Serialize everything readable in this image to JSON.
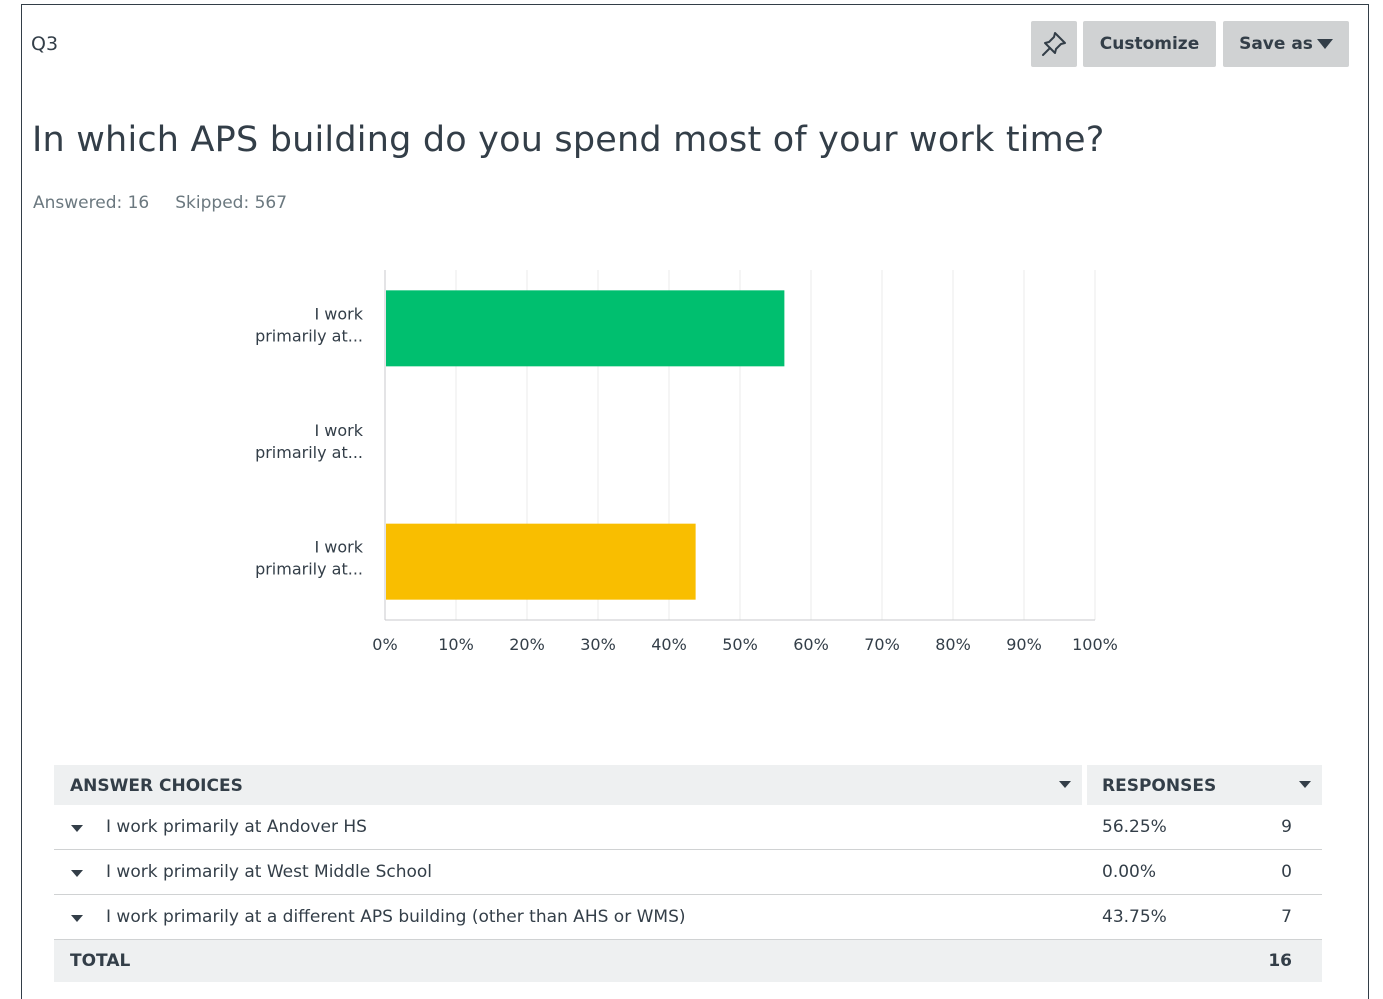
{
  "question": {
    "number": "Q3",
    "title": "In which APS building do you spend most of your work time?",
    "answered_label": "Answered: 16",
    "skipped_label": "Skipped: 567"
  },
  "toolbar": {
    "pin_icon": "pin-icon",
    "customize_label": "Customize",
    "save_as_label": "Save as"
  },
  "chart_data": {
    "type": "bar",
    "orientation": "horizontal",
    "categories": [
      "I work primarily at...",
      "I work primarily at...",
      "I work primarily at..."
    ],
    "category_lines": [
      [
        "I work",
        "primarily at..."
      ],
      [
        "I work",
        "primarily at..."
      ],
      [
        "I work",
        "primarily at..."
      ]
    ],
    "values": [
      56.25,
      0,
      43.75
    ],
    "colors": [
      "#00bf6f",
      "#6bc8cd",
      "#f9be00"
    ],
    "xlim": [
      0,
      100
    ],
    "xticks": [
      "0%",
      "10%",
      "20%",
      "30%",
      "40%",
      "50%",
      "60%",
      "70%",
      "80%",
      "90%",
      "100%"
    ],
    "grid": true
  },
  "table": {
    "header_choices": "ANSWER CHOICES",
    "header_responses": "RESPONSES",
    "rows": [
      {
        "choice": "I work primarily at Andover HS",
        "percent": "56.25%",
        "count": "9"
      },
      {
        "choice": "I work primarily at West Middle School",
        "percent": "0.00%",
        "count": "0"
      },
      {
        "choice": "I work primarily at a different APS building (other than AHS or WMS)",
        "percent": "43.75%",
        "count": "7"
      }
    ],
    "total_label": "TOTAL",
    "total_value": "16"
  }
}
